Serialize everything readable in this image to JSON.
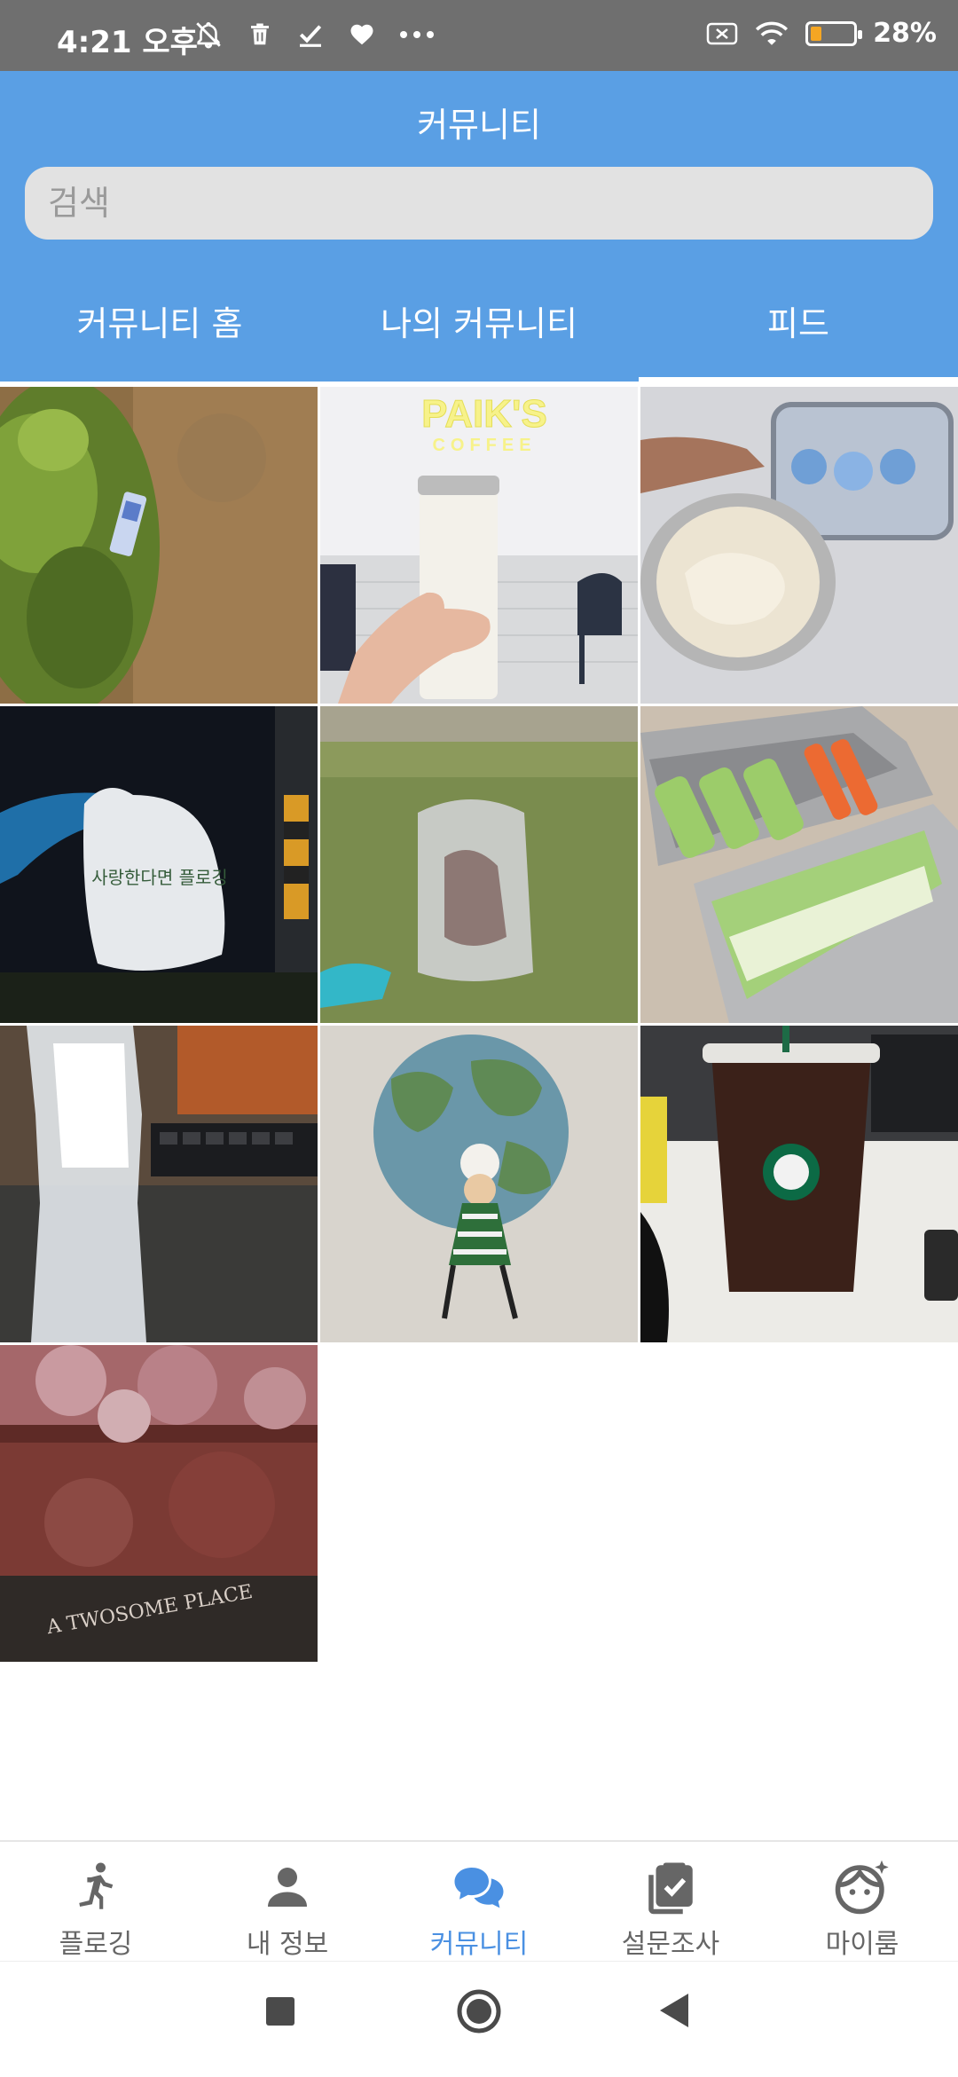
{
  "status_bar": {
    "time": "4:21 오후",
    "battery": "28%",
    "battery_level": 0.28,
    "battery_color": "#f5a623",
    "left_icons": [
      "notifications-off-icon",
      "trash-icon",
      "check-icon",
      "heart-icon",
      "more-dots-icon"
    ],
    "right_icons": [
      "sim-x-icon",
      "wifi-icon",
      "battery-icon"
    ]
  },
  "header": {
    "title": "커뮤니티",
    "search_placeholder": "검색",
    "bg_color": "#5a9fe4"
  },
  "tabs": [
    {
      "label": "커뮤니티 홈",
      "active": false
    },
    {
      "label": "나의 커뮤니티",
      "active": false
    },
    {
      "label": "피드",
      "active": true
    }
  ],
  "feed": {
    "photos": [
      {
        "name": "photo-trash-on-grass"
      },
      {
        "name": "photo-paiks-coffee-tumbler",
        "sign_text": "PAIK'S",
        "sign_sub": "COFFEE"
      },
      {
        "name": "photo-ice-cream-container"
      },
      {
        "name": "photo-plogging-bag-night",
        "bag_text": "사랑한다면 플로깅"
      },
      {
        "name": "photo-plastic-bag-on-grass"
      },
      {
        "name": "photo-vegetables-lunchbox"
      },
      {
        "name": "photo-plastic-bottle-desk"
      },
      {
        "name": "photo-paper-bag-earth"
      },
      {
        "name": "photo-starbucks-cup"
      },
      {
        "name": "photo-iced-drink-glass",
        "glass_text": "A TWOSOME PLACE"
      }
    ]
  },
  "bottom_nav": [
    {
      "label": "플로깅",
      "icon": "running-icon",
      "active": false
    },
    {
      "label": "내 정보",
      "icon": "person-icon",
      "active": false
    },
    {
      "label": "커뮤니티",
      "icon": "chat-bubbles-icon",
      "active": true
    },
    {
      "label": "설문조사",
      "icon": "survey-clipboard-icon",
      "active": false
    },
    {
      "label": "마이룸",
      "icon": "face-sparkle-icon",
      "active": false
    }
  ],
  "accent_color": "#4a90e2",
  "system_nav": [
    "recents-square-icon",
    "home-circle-icon",
    "back-triangle-icon"
  ]
}
